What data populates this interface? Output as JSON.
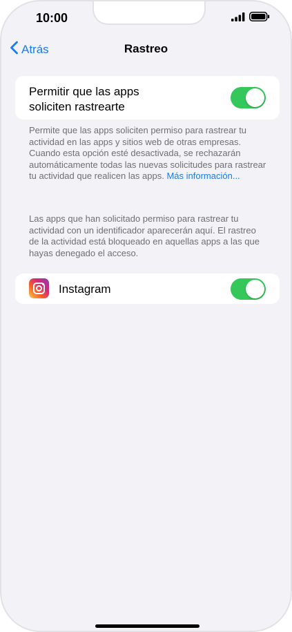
{
  "status_bar": {
    "time": "10:00",
    "icons": [
      "signal-icon",
      "battery-icon"
    ]
  },
  "nav": {
    "back_label": "Atrás",
    "back_icon": "chevron-left-icon",
    "title": "Rastreo"
  },
  "main_setting": {
    "label_line1": "Permitir que las apps",
    "label_line2": "soliciten rastrearte",
    "toggle_on": true
  },
  "footnote_1": {
    "text": "Permite que las apps soliciten permiso para rastrear tu actividad en las apps y sitios web de otras empresas. Cuando esta opción esté desactivada, se rechazarán automáticamente todas las nuevas solicitudes para rastrear tu actividad que realicen las apps. ",
    "link_text": "Más información..."
  },
  "footnote_2": {
    "text": "Las apps que han solicitado permiso para rastrear tu actividad con un identificador aparecerán aquí. El rastreo de la actividad está bloqueado en aquellas apps a las que hayas denegado el acceso."
  },
  "apps": [
    {
      "name": "Instagram",
      "icon": "instagram-icon",
      "toggle_on": true
    }
  ],
  "colors": {
    "accent": "#1a7bf2",
    "toggle_on": "#34c759",
    "background": "#f2f2f7",
    "footnote": "#6e6e73"
  }
}
